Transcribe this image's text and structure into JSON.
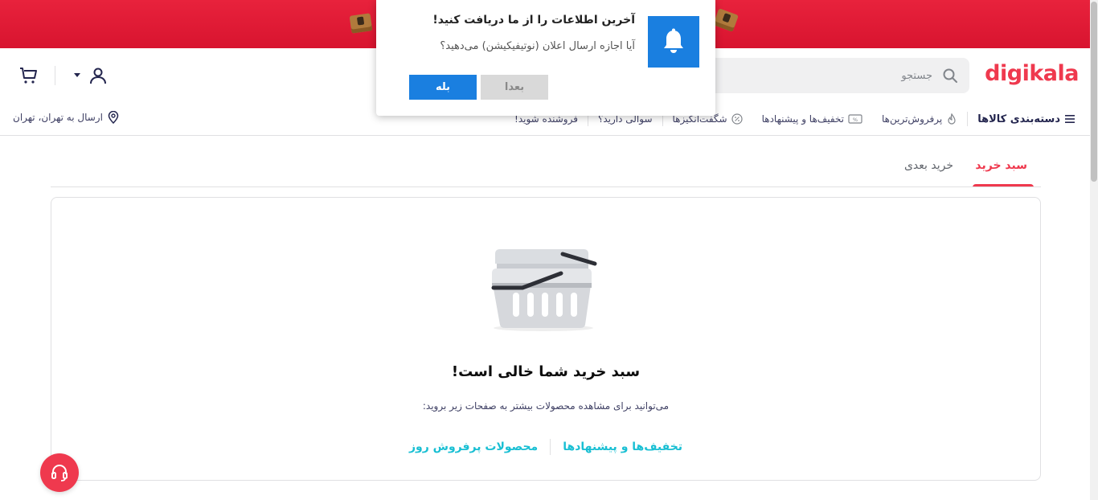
{
  "popup": {
    "title": "آخرین اطلاعات را از ما دریافت کنید!",
    "text": "آیا اجازه ارسال اعلان (نوتیفیکیشن) می‌دهید؟",
    "later_label": "بعدا",
    "yes_label": "بله",
    "icon": "bell-icon",
    "accent": "#1a7fe0"
  },
  "header": {
    "logo": "digikala",
    "search_placeholder": "جستجو",
    "brand_color": "#ef394e"
  },
  "nav": {
    "categories": "دسته‌بندی کالاها",
    "items": [
      "پرفروش‌ترین‌ها",
      "تخفیف‌ها و پیشنهادها",
      "شگفت‌انگیزها",
      "سوالی دارید؟",
      "فروشنده شوید!"
    ],
    "location": "ارسال به تهران، تهران"
  },
  "tabs": {
    "cart": "سبد خرید",
    "next_purchase": "خرید بعدی"
  },
  "empty_cart": {
    "title": "سبد خرید شما خالی است!",
    "subtitle": "می‌توانید برای مشاهده محصولات بیشتر به صفحات زیر بروید:",
    "link_offers": "تخفیف‌ها و پیشنهادها",
    "link_bestsellers": "محصولات پرفروش روز",
    "link_color": "#19bfd3"
  }
}
